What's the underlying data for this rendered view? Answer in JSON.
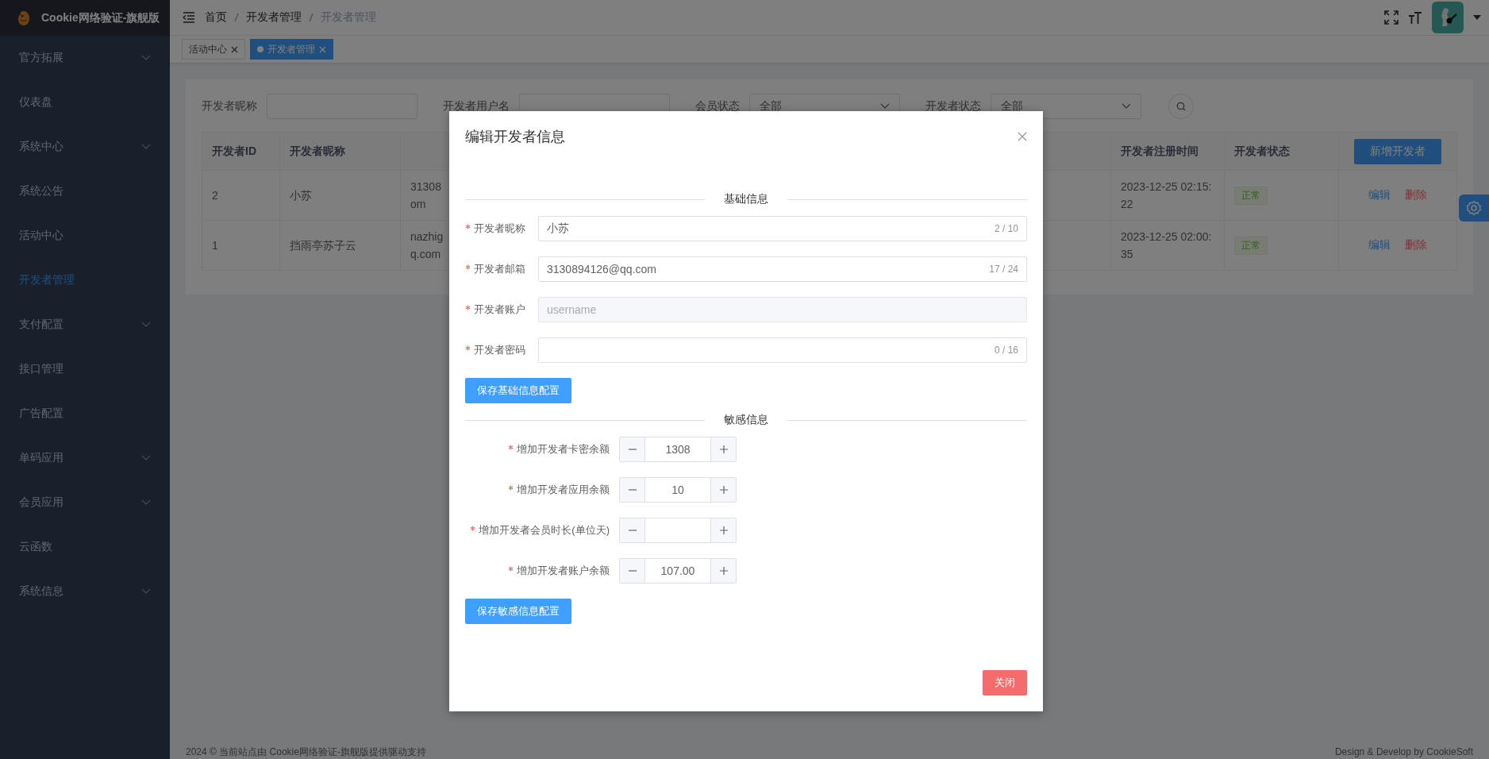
{
  "app": {
    "title": "Cookie网络验证-旗舰版"
  },
  "sidebar": {
    "items": [
      {
        "label": "官方拓展",
        "kind": "submenu",
        "selected": false
      },
      {
        "label": "仪表盘",
        "kind": "link",
        "selected": false
      },
      {
        "label": "系统中心",
        "kind": "submenu",
        "selected": false
      },
      {
        "label": "系统公告",
        "kind": "link",
        "selected": false
      },
      {
        "label": "活动中心",
        "kind": "link",
        "selected": false
      },
      {
        "label": "开发者管理",
        "kind": "link",
        "selected": true
      },
      {
        "label": "支付配置",
        "kind": "submenu",
        "selected": false
      },
      {
        "label": "接口管理",
        "kind": "link",
        "selected": false
      },
      {
        "label": "广告配置",
        "kind": "link",
        "selected": false
      },
      {
        "label": "单码应用",
        "kind": "submenu",
        "selected": false
      },
      {
        "label": "会员应用",
        "kind": "submenu",
        "selected": false
      },
      {
        "label": "云函数",
        "kind": "link",
        "selected": false
      },
      {
        "label": "系统信息",
        "kind": "submenu",
        "selected": false
      }
    ]
  },
  "breadcrumb": [
    "首页",
    "开发者管理",
    "开发者管理"
  ],
  "tabs": [
    {
      "label": "活动中心",
      "selected": false
    },
    {
      "label": "开发者管理",
      "selected": true
    }
  ],
  "filters": [
    {
      "label": "开发者昵称",
      "kind": "text"
    },
    {
      "label": "开发者用户名",
      "kind": "text"
    },
    {
      "label": "会员状态",
      "kind": "select",
      "value": "全部"
    },
    {
      "label": "开发者状态",
      "kind": "select",
      "value": "全部"
    }
  ],
  "table": {
    "columns": [
      "开发者ID",
      "开发者昵称",
      "开发者注册时间",
      "开发者状态"
    ],
    "add_button": "新增开发者",
    "rows": [
      {
        "id": "2",
        "nickname": "小苏",
        "column_3": "31308\nom",
        "registered": "2023-12-25 02:15:22",
        "status": "正常",
        "actions": [
          "编辑",
          "删除"
        ]
      },
      {
        "id": "1",
        "nickname": "挡雨亭苏子云",
        "column_3": "nazhig\nq.com",
        "registered": "2023-12-25 02:00:35",
        "status": "正常",
        "actions": [
          "编辑",
          "删除"
        ]
      }
    ]
  },
  "footer": {
    "left": "2024 © 当前站点由 Cookie网络验证-旗舰版提供驱动支持",
    "right": "Design & Develop by CookieSoft"
  },
  "dialog": {
    "title": "编辑开发者信息",
    "sections": [
      {
        "title": "基础信息",
        "kind": "text",
        "fields": [
          {
            "label": "开发者昵称",
            "required": true,
            "value": "小苏",
            "counter": "2 / 10",
            "disabled": false
          },
          {
            "label": "开发者邮箱",
            "required": true,
            "value": "3130894126@qq.com",
            "counter": "17 / 24",
            "disabled": false
          },
          {
            "label": "开发者账户",
            "required": true,
            "placeholder": "username",
            "disabled": true
          },
          {
            "label": "开发者密码",
            "required": true,
            "counter": "0 / 16",
            "disabled": false
          }
        ],
        "button": "保存基础信息配置"
      },
      {
        "title": "敏感信息",
        "kind": "number",
        "fields": [
          {
            "label": "增加开发者卡密余额",
            "required": true,
            "value": "1308"
          },
          {
            "label": "增加开发者应用余额",
            "required": true,
            "value": "10"
          },
          {
            "label": "增加开发者会员时长(单位天)",
            "required": true
          },
          {
            "label": "增加开发者账户余额",
            "required": true,
            "value": "107.00"
          }
        ],
        "button": "保存敏感信息配置"
      }
    ],
    "close_button": "关闭"
  }
}
